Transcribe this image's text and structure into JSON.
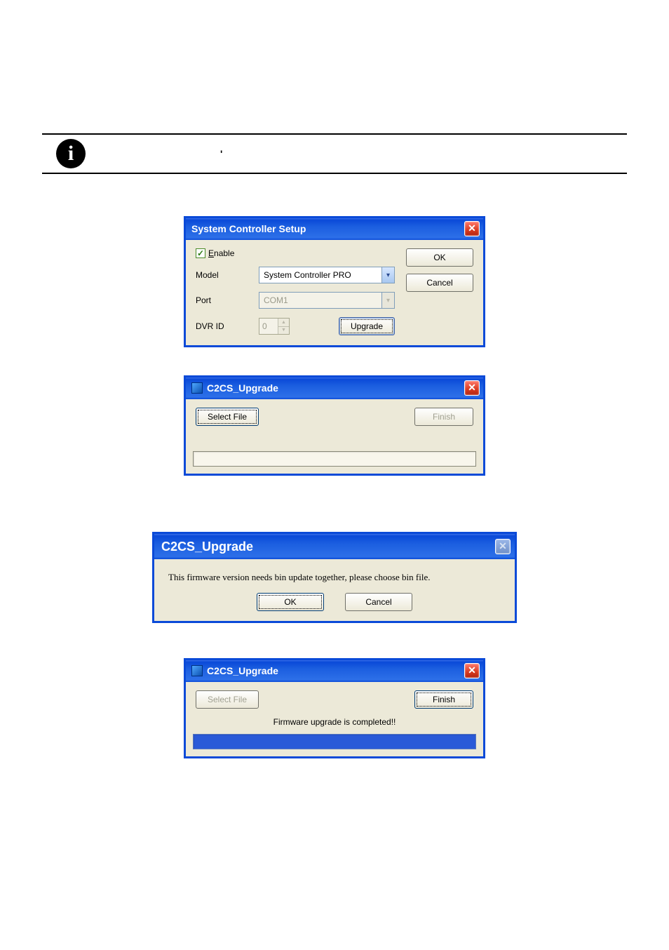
{
  "info_icon_char": "i",
  "tick_mark": "✓",
  "dialog1": {
    "title": "System Controller Setup",
    "enable_label_pre": "E",
    "enable_label_post": "nable",
    "enable_checked": true,
    "model_label": "Model",
    "model_value": "System Controller PRO",
    "port_label": "Port",
    "port_value": "COM1",
    "dvrid_label": "DVR ID",
    "dvrid_value": "0",
    "upgrade_btn": "Upgrade",
    "ok_btn": "OK",
    "cancel_btn": "Cancel"
  },
  "dialog2": {
    "title": "C2CS_Upgrade",
    "select_file_btn": "Select File",
    "finish_btn": "Finish"
  },
  "dialog3": {
    "title": "C2CS_Upgrade",
    "message": "This firmware version needs bin update together, please choose bin file.",
    "ok_btn": "OK",
    "cancel_btn": "Cancel"
  },
  "dialog4": {
    "title": "C2CS_Upgrade",
    "select_file_btn": "Select File",
    "finish_btn": "Finish",
    "status": "Firmware upgrade is completed!!"
  }
}
